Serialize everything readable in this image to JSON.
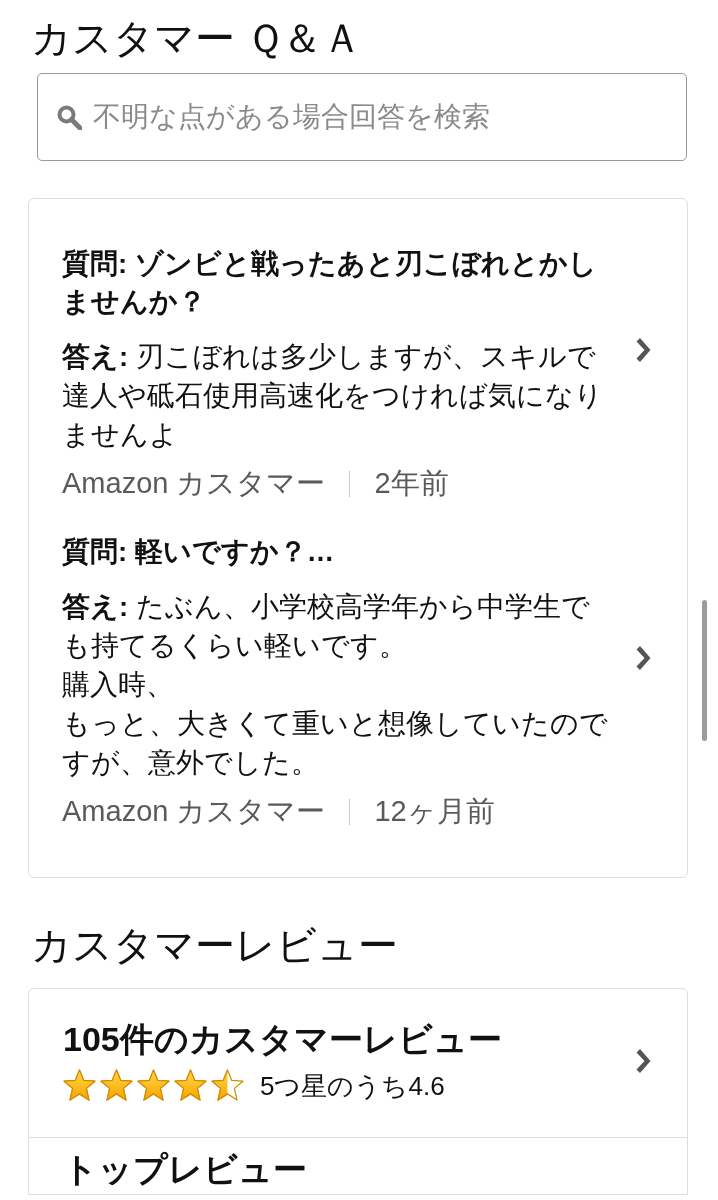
{
  "qa": {
    "title": "カスタマー Ｑ＆Ａ",
    "search": {
      "placeholder": "不明な点がある場合回答を検索"
    },
    "items": [
      {
        "question": "質問: ゾンビと戦ったあと刃こぼれとかしませんか？",
        "answer": [
          "**答え:** 刃こぼれは多少しますが、スキルで達人や砥石使用高速化をつければ気になりませんよ"
        ],
        "author": "Amazon カスタマー",
        "date": "2年前"
      },
      {
        "question": "質問: 軽いですか？…",
        "answer": [
          "**答え:** たぶん、小学校高学年から中学生でも持てるくらい軽いです。",
          "購入時、",
          "もっと、大きくて重いと想像していたのですが、意外でした。"
        ],
        "author": "Amazon カスタマー",
        "date": "12ヶ月前"
      }
    ]
  },
  "reviews": {
    "title": "カスタマーレビュー",
    "rows": [
      {
        "kind": "summary",
        "title": "105件のカスタマーレビュー",
        "stars": 4.5,
        "rating": "5つ星のうち4.6"
      },
      {
        "kind": "link",
        "title": "トップレビュー"
      }
    ]
  }
}
